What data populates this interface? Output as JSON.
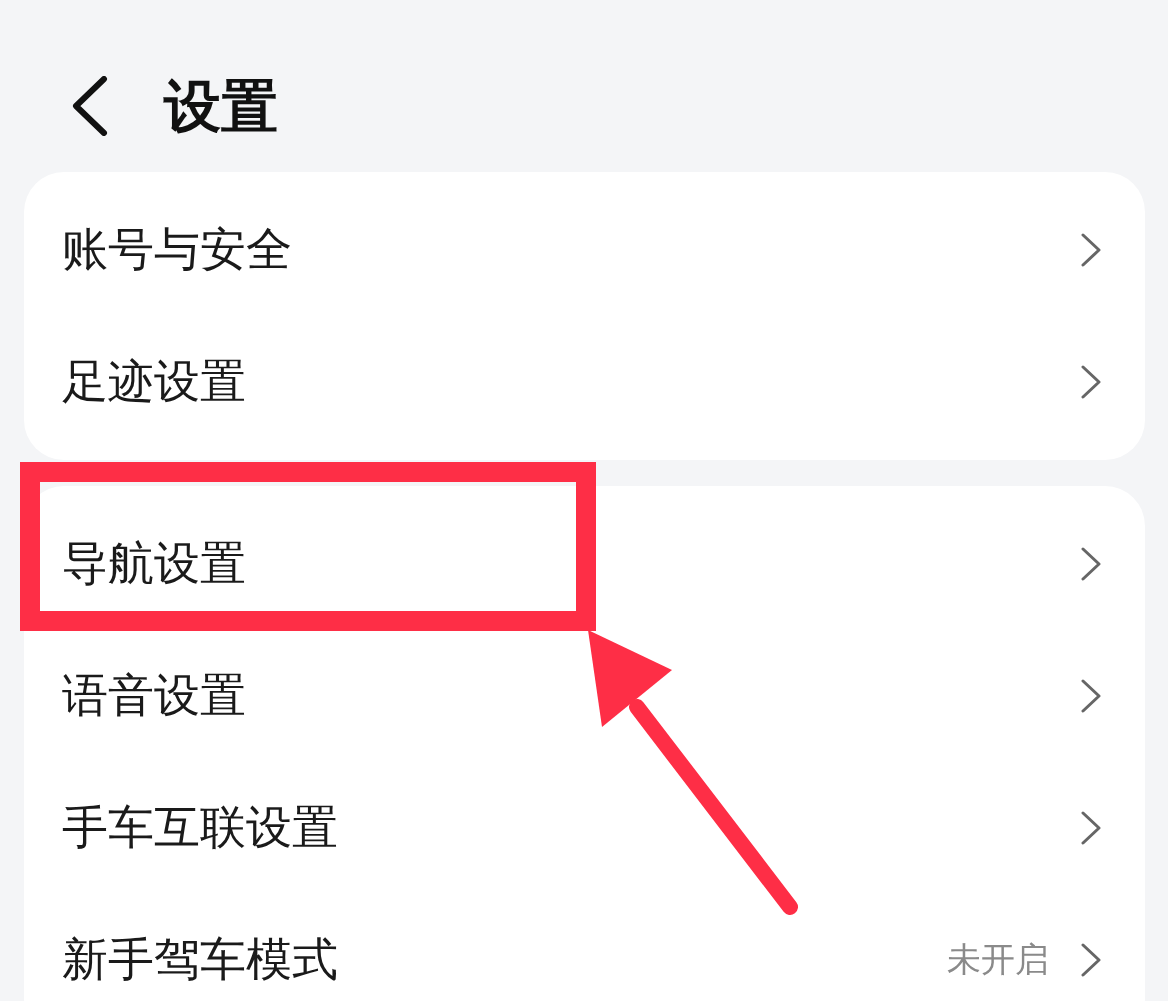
{
  "header": {
    "title": "设置"
  },
  "groups": [
    {
      "items": [
        {
          "label": "账号与安全",
          "highlighted": false
        },
        {
          "label": "足迹设置",
          "highlighted": false
        }
      ]
    },
    {
      "items": [
        {
          "label": "导航设置",
          "highlighted": true
        },
        {
          "label": "语音设置",
          "highlighted": false
        },
        {
          "label": "手车互联设置",
          "highlighted": false
        },
        {
          "label": "新手驾车模式",
          "value": "未开启",
          "highlighted": false
        }
      ]
    }
  ]
}
